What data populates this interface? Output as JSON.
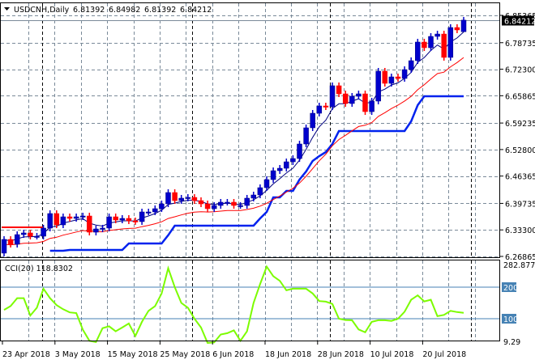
{
  "header": {
    "symbol": "USDCNH,Daily",
    "open": "6.81392",
    "high": "6.84982",
    "low": "6.81392",
    "close": "6.84212",
    "menu_icon": "triangle-down-icon"
  },
  "chart_data": {
    "type": "candlestick",
    "title": "USDCNH,Daily",
    "ylim": [
      6.26865,
      6.85365
    ],
    "y_ticks": [
      "6.85365",
      "6.78735",
      "6.72300",
      "6.65865",
      "6.59235",
      "6.52800",
      "6.46365",
      "6.39735",
      "6.33300",
      "6.26865"
    ],
    "last_price_label": "6.84212",
    "x_labels": [
      "23 Apr 2018",
      "3 May 2018",
      "15 May 2018",
      "25 May 2018",
      "6 Jun 2018",
      "18 Jun 2018",
      "28 Jun 2018",
      "10 Jul 2018",
      "20 Jul 2018"
    ],
    "x_label_bars": [
      0,
      8,
      16,
      24,
      32,
      40,
      48,
      56,
      64
    ],
    "grid": true,
    "colors": {
      "up": "#0000cc",
      "down": "#ff0000",
      "fast_ma": "#000080",
      "slow_ma": "#ff0000",
      "stop_line": "#0022ee",
      "stop_line_early": "#ff0000",
      "cci": "#7cfc00",
      "level": "#4682b4"
    },
    "close": [
      6.3099,
      6.2981,
      6.3216,
      6.3256,
      6.3177,
      6.3177,
      6.3374,
      6.3727,
      6.3452,
      6.3648,
      6.3609,
      6.3648,
      6.3668,
      6.3275,
      6.3354,
      6.3374,
      6.3648,
      6.357,
      6.3609,
      6.355,
      6.3531,
      6.3766,
      6.3766,
      6.3845,
      6.3962,
      6.4237,
      6.4041,
      6.41,
      6.4119,
      6.4041,
      6.3962,
      6.3845,
      6.3923,
      6.4002,
      6.4002,
      6.3923,
      6.3923,
      6.41,
      6.4178,
      6.4355,
      6.4551,
      6.4767,
      6.4826,
      6.4983,
      6.5062,
      6.5415,
      6.5808,
      6.6161,
      6.6338,
      6.6318,
      6.6829,
      6.6632,
      6.6397,
      6.6573,
      6.6632,
      6.62,
      6.6456,
      6.7182,
      6.6887,
      6.7044,
      6.7005,
      6.7221,
      6.7437,
      6.7889,
      6.7751,
      6.8026,
      6.8084,
      6.7516,
      6.8242,
      6.8183,
      6.84212
    ],
    "first_open": 6.2766,
    "stop_line_early": {
      "from_bar": 0,
      "to_bar": 6,
      "value": 6.3393
    },
    "stop_line": [
      null,
      null,
      null,
      null,
      null,
      null,
      null,
      6.2824,
      6.2824,
      6.2824,
      6.2843,
      6.2843,
      6.2843,
      6.2843,
      6.2843,
      6.2843,
      6.2843,
      6.2843,
      6.2843,
      6.3,
      6.3,
      6.3,
      6.3,
      6.3,
      6.3,
      6.32,
      6.3432,
      6.3432,
      6.3432,
      6.3432,
      6.3432,
      6.3432,
      6.3432,
      6.3432,
      6.3432,
      6.3432,
      6.3432,
      6.3432,
      6.3432,
      6.3609,
      6.3766,
      6.4119,
      6.4119,
      6.4276,
      6.4276,
      6.4551,
      6.4748,
      6.5003,
      6.5121,
      6.5219,
      6.5415,
      6.5729,
      6.5729,
      6.5729,
      6.5729,
      6.5729,
      6.5729,
      6.5729,
      6.5729,
      6.5729,
      6.5729,
      6.5729,
      6.5964,
      6.6357,
      6.6574,
      6.6574,
      6.6574,
      6.6574,
      6.6574,
      6.6574,
      6.6574
    ],
    "cci": {
      "label": "CCI(20) 118.8302",
      "ylim": [
        9.29,
        282.8772
      ],
      "y_ticks": [
        "282.8772",
        "200",
        "100",
        "9.29"
      ],
      "levels": [
        200,
        100
      ],
      "values": [
        128,
        140,
        165,
        165,
        110,
        135,
        195,
        165,
        143,
        130,
        120,
        118,
        65,
        30,
        26,
        70,
        76,
        60,
        72,
        85,
        45,
        90,
        125,
        140,
        180,
        260,
        200,
        150,
        135,
        100,
        72,
        23,
        25,
        50,
        54,
        63,
        30,
        60,
        150,
        210,
        265,
        235,
        220,
        190,
        195,
        195,
        195,
        180,
        156,
        154,
        147,
        100,
        96,
        95,
        66,
        57,
        90,
        95,
        95,
        93,
        100,
        122,
        160,
        174,
        155,
        160,
        108,
        112,
        125,
        121,
        118.83
      ]
    }
  }
}
